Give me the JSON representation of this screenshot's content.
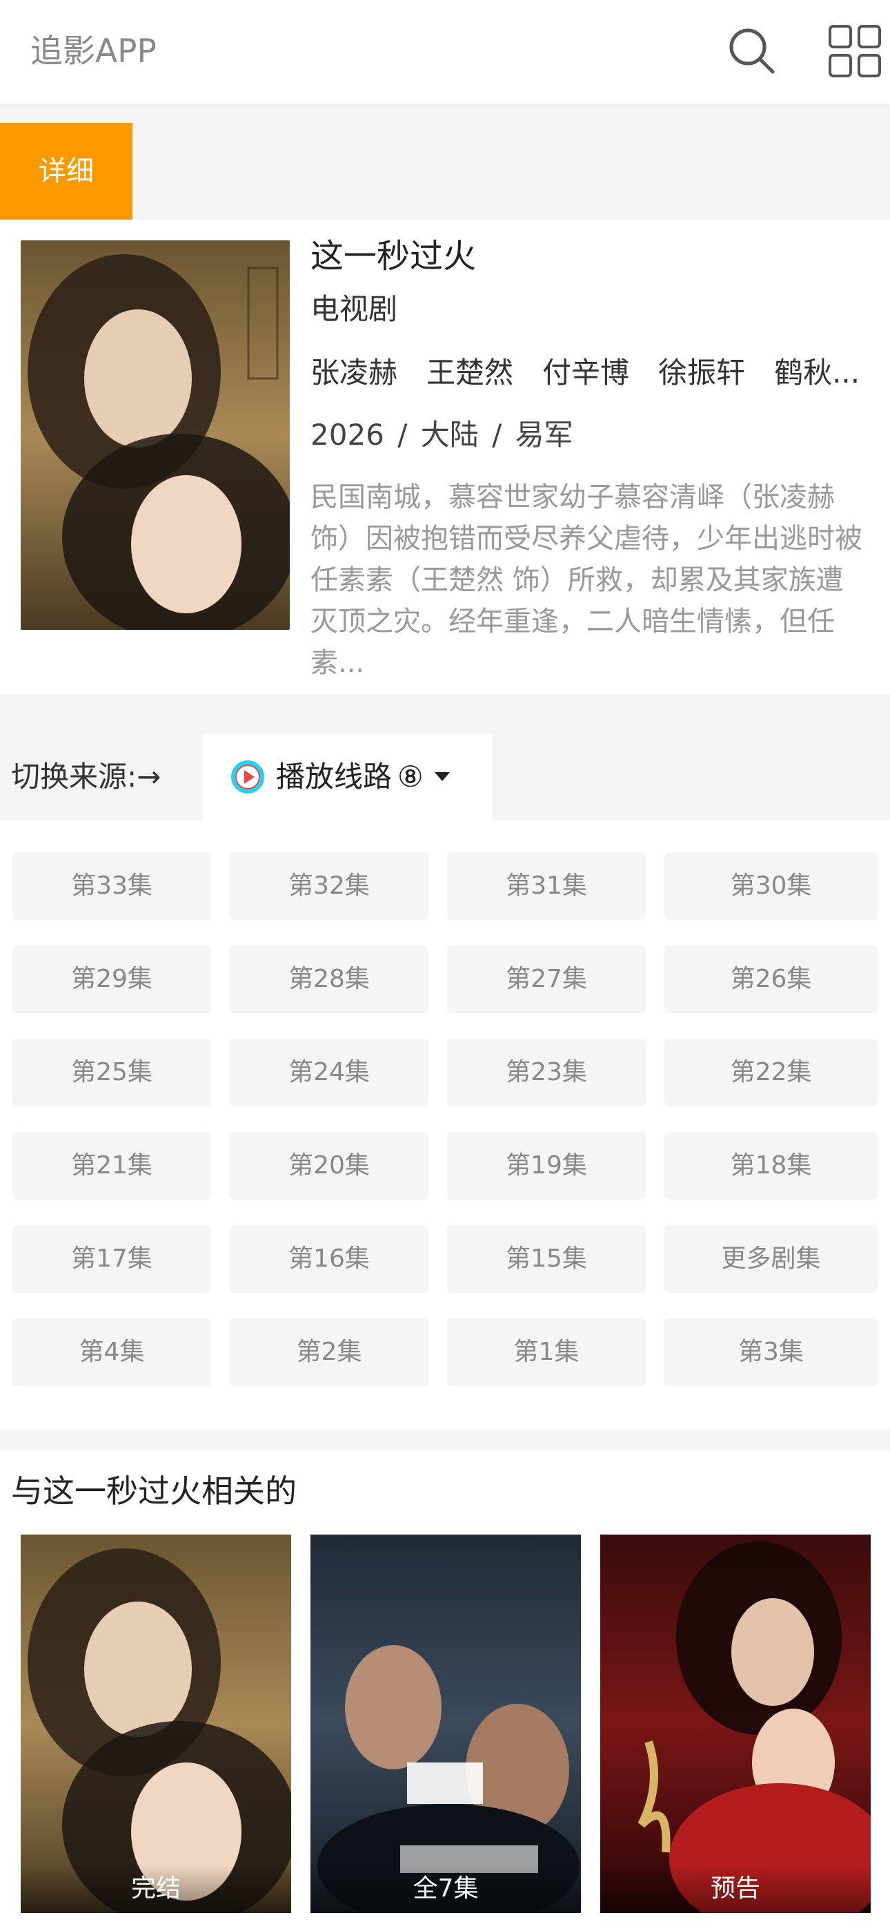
{
  "header": {
    "app_title": "追影APP",
    "search_icon": "search-icon",
    "menu_icon": "grid-icon"
  },
  "detail_tab": {
    "label": "详细",
    "color": "#ff9900"
  },
  "show": {
    "title": "这一秒过火",
    "type": "电视剧",
    "cast": [
      "张凌赫",
      "王楚然",
      "付辛博",
      "徐振轩",
      "鹤秋..."
    ],
    "year": "2026",
    "region": "大陆",
    "director": "易军",
    "separator": "/",
    "synopsis": "民国南城，慕容世家幼子慕容清峄（张凌赫 饰）因被抱错而受尽养父虐待，少年出逃时被任素素（王楚然 饰）所救，却累及其家族遭灭顶之灾。经年重逢，二人暗生情愫，但任素..."
  },
  "source": {
    "label": "切换来源:→",
    "route_label": "播放线路",
    "route_count": "⑧",
    "play_icon": "play-circle-icon",
    "dropdown_icon": "caret-down-icon"
  },
  "episodes": [
    "第33集",
    "第32集",
    "第31集",
    "第30集",
    "第29集",
    "第28集",
    "第27集",
    "第26集",
    "第25集",
    "第24集",
    "第23集",
    "第22集",
    "第21集",
    "第20集",
    "第19集",
    "第18集",
    "第17集",
    "第16集",
    "第15集",
    "更多剧集",
    "第4集",
    "第2集",
    "第1集",
    "第3集"
  ],
  "related": {
    "title": "与这一秒过火相关的",
    "items": [
      {
        "badge": "完结"
      },
      {
        "badge": "全7集"
      },
      {
        "badge": "预告"
      }
    ]
  }
}
